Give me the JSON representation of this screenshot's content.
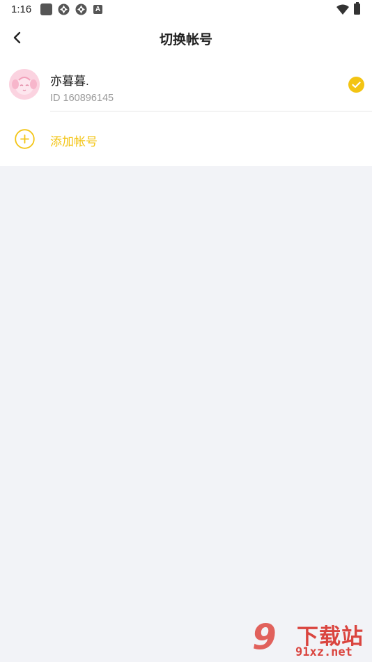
{
  "status_bar": {
    "time": "1:16",
    "icons": [
      "app-square-icon",
      "aperture-icon",
      "aperture-icon",
      "a-badge-icon",
      "wifi-icon",
      "battery-icon"
    ],
    "a_badge": "A"
  },
  "nav": {
    "back_icon": "chevron-left-icon",
    "title": "切换帐号"
  },
  "account": {
    "name": "亦暮暮.",
    "id_label": "ID 160896145",
    "selected": true,
    "check_color": "#f3c413"
  },
  "add_account": {
    "label": "添加帐号",
    "icon": "plus-circle-icon",
    "color": "#f3c413"
  },
  "watermark": {
    "logo_text": "9",
    "title": "下载站",
    "url": "91xz.net"
  }
}
